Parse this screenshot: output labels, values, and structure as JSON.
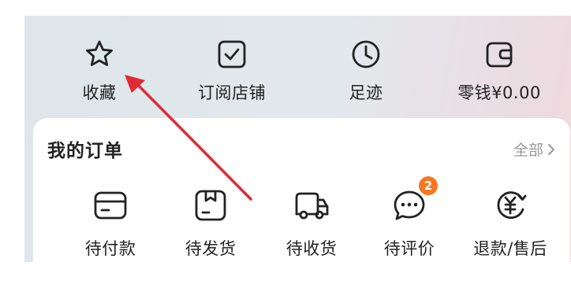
{
  "quick_links": [
    {
      "label": "收藏",
      "icon": "star-icon"
    },
    {
      "label": "订阅店铺",
      "icon": "checkbox-icon"
    },
    {
      "label": "足迹",
      "icon": "clock-icon"
    },
    {
      "label": "零钱¥0.00",
      "icon": "wallet-icon"
    }
  ],
  "orders": {
    "title": "我的订单",
    "all_label": "全部",
    "items": [
      {
        "label": "待付款",
        "icon": "card-icon"
      },
      {
        "label": "待发货",
        "icon": "box-icon"
      },
      {
        "label": "待收货",
        "icon": "truck-icon"
      },
      {
        "label": "待评价",
        "icon": "chat-icon",
        "badge": "2"
      },
      {
        "label": "退款/售后",
        "icon": "refund-icon"
      }
    ]
  },
  "colors": {
    "badge": "#f57723",
    "annotation_arrow": "#e02a36",
    "card_background": "#ffffff",
    "text": "#222222",
    "muted_text": "#999999"
  }
}
